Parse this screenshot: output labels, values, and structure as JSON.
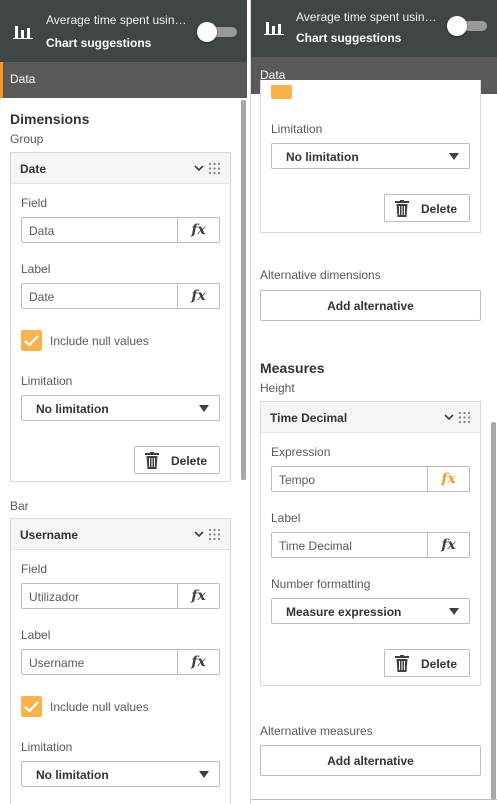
{
  "header": {
    "title": "Average time spent usin…",
    "subtitle": "Chart suggestions",
    "toggle_on": false
  },
  "tabs": {
    "data_label": "Data"
  },
  "left": {
    "dimensions_title": "Dimensions",
    "group_label": "Group",
    "bar_label": "Bar",
    "date_card": {
      "name": "Date",
      "field_label": "Field",
      "field_value": "Data",
      "label_label": "Label",
      "label_value": "Date",
      "include_null": "Include null values",
      "limitation_label": "Limitation",
      "limitation_value": "No limitation",
      "delete": "Delete"
    },
    "username_card": {
      "name": "Username",
      "field_label": "Field",
      "field_value": "Utilizador",
      "label_label": "Label",
      "label_value": "Username",
      "include_null": "Include null values",
      "limitation_label": "Limitation",
      "limitation_value": "No limitation"
    }
  },
  "right": {
    "limitation_label": "Limitation",
    "limitation_value": "No limitation",
    "delete": "Delete",
    "alt_dimensions_label": "Alternative dimensions",
    "add_alternative": "Add alternative",
    "measures_title": "Measures",
    "height_label": "Height",
    "measure_card": {
      "name": "Time Decimal",
      "expression_label": "Expression",
      "expression_value": "Tempo",
      "label_label": "Label",
      "label_value": "Time Decimal",
      "number_format_label": "Number formatting",
      "number_format_value": "Measure expression",
      "delete": "Delete"
    },
    "alt_measures_label": "Alternative measures",
    "add_alternative_2": "Add alternative"
  },
  "icons": {
    "chart": "bar-chart-icon",
    "chevron": "chevron-down-icon",
    "grip": "drag-handle-icon",
    "trash": "trash-icon",
    "fx": "fx",
    "check": "checkmark-icon",
    "caret": "caret-down-icon"
  },
  "colors": {
    "header_bg": "#404548",
    "tab_bg": "#595959",
    "accent": "#f8981d",
    "checkbox": "#f8b34c"
  }
}
